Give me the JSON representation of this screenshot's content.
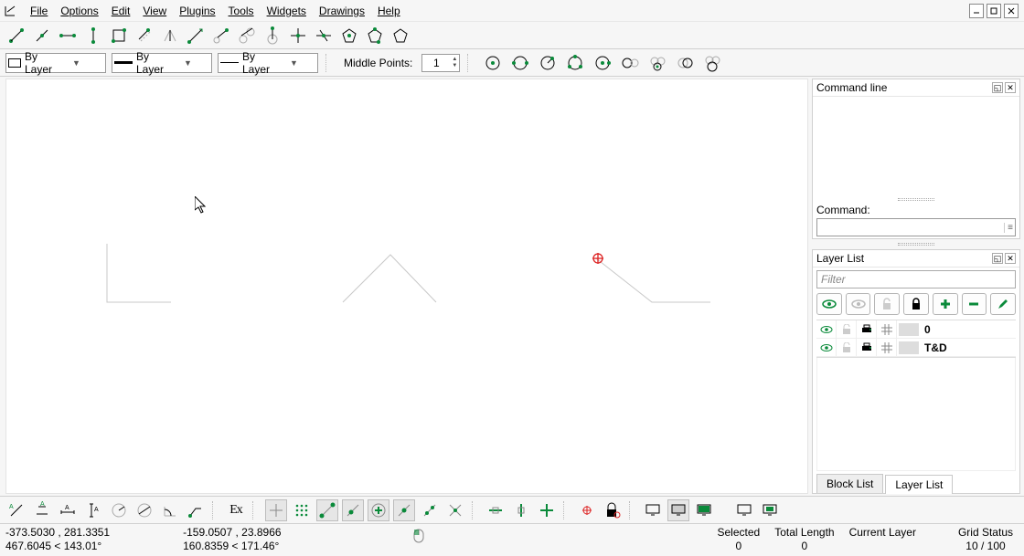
{
  "menu": [
    "File",
    "Options",
    "Edit",
    "View",
    "Plugins",
    "Tools",
    "Widgets",
    "Drawings",
    "Help"
  ],
  "props": {
    "color_combo": "By Layer",
    "width_combo": "By Layer",
    "ltype_combo": "By Layer",
    "middle_label": "Middle Points:",
    "middle_value": "1"
  },
  "side": {
    "cmdline_title": "Command line",
    "command_label": "Command:",
    "layer_title": "Layer List",
    "filter_placeholder": "Filter",
    "layers": [
      {
        "name": "0"
      },
      {
        "name": "T&D"
      }
    ],
    "tab_block": "Block List",
    "tab_layer": "Layer List"
  },
  "bottom_ex": "Ex",
  "status": {
    "abs1": "-373.5030 , 281.3351",
    "rel1": "467.6045 < 143.01°",
    "abs2": "-159.0507 , 23.8966",
    "rel2": "160.8359 < 171.46°",
    "selected_label": "Selected",
    "selected_value": "0",
    "total_label": "Total Length",
    "total_value": "0",
    "layer_label": "Current Layer",
    "grid_label": "Grid Status",
    "grid_value": "10 / 100"
  }
}
